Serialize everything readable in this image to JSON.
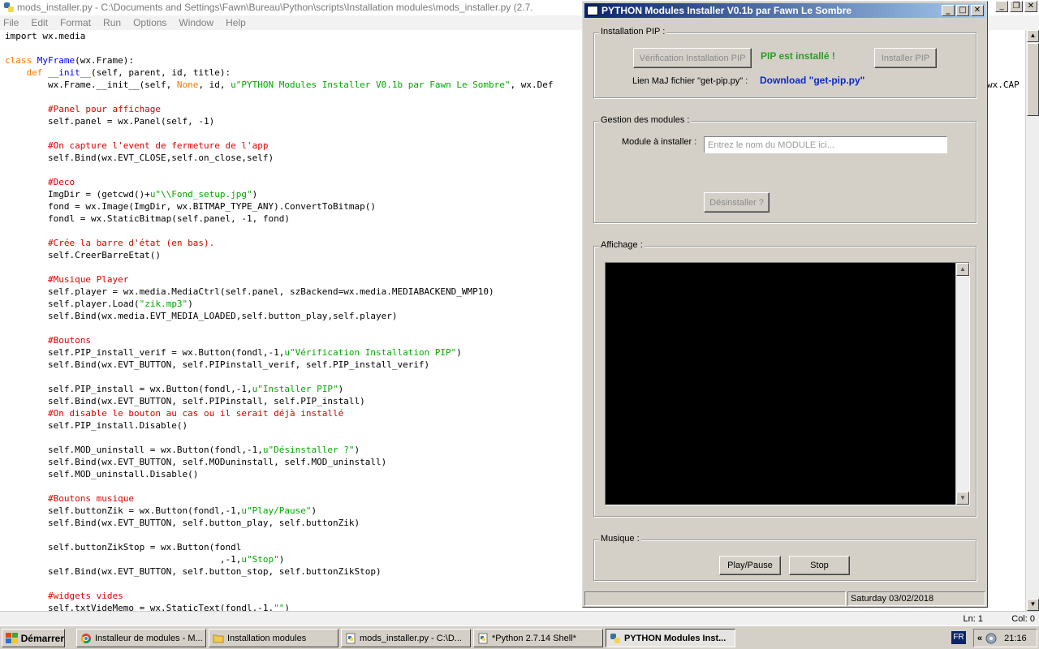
{
  "editor": {
    "title": "mods_installer.py - C:\\Documents and Settings\\Fawn\\Bureau\\Python\\scripts\\Installation modules\\mods_installer.py (2.7.",
    "menu": [
      "File",
      "Edit",
      "Format",
      "Run",
      "Options",
      "Window",
      "Help"
    ],
    "status_line": "Ln: 1",
    "status_col": "Col: 0",
    "code_lines": [
      [
        {
          "t": "import wx.media",
          "c": ""
        }
      ],
      [],
      [
        {
          "t": "class ",
          "c": "kw"
        },
        {
          "t": "MyFrame",
          "c": "cls"
        },
        {
          "t": "(wx.Frame):",
          "c": ""
        }
      ],
      [
        {
          "t": "    ",
          "c": ""
        },
        {
          "t": "def ",
          "c": "kw"
        },
        {
          "t": "__init__",
          "c": "cls"
        },
        {
          "t": "(self, parent, id, title):",
          "c": ""
        }
      ],
      [
        {
          "t": "        wx.Frame.__init__(self, ",
          "c": ""
        },
        {
          "t": "None",
          "c": "kw"
        },
        {
          "t": ", id, ",
          "c": ""
        },
        {
          "t": "u\"PYTHON Modules Installer V0.1b par Fawn Le Sombre\"",
          "c": "str"
        },
        {
          "t": ", wx.Def",
          "c": ""
        }
      ],
      [],
      [
        {
          "t": "        #Panel pour affichage",
          "c": "cmt"
        }
      ],
      [
        {
          "t": "        self.panel = wx.Panel(self, -1)",
          "c": ""
        }
      ],
      [],
      [
        {
          "t": "        #On capture l'event de fermeture de l'app",
          "c": "cmt"
        }
      ],
      [
        {
          "t": "        self.Bind(wx.EVT_CLOSE,self.on_close,self)",
          "c": ""
        }
      ],
      [],
      [
        {
          "t": "        #Deco",
          "c": "cmt"
        }
      ],
      [
        {
          "t": "        ImgDir = (getcwd()+",
          "c": ""
        },
        {
          "t": "u\"\\\\Fond_setup.jpg\"",
          "c": "str"
        },
        {
          "t": ")",
          "c": ""
        }
      ],
      [
        {
          "t": "        fond = wx.Image(ImgDir, wx.BITMAP_TYPE_ANY).ConvertToBitmap()",
          "c": ""
        }
      ],
      [
        {
          "t": "        fondl = wx.StaticBitmap(self.panel, -1, fond)",
          "c": ""
        }
      ],
      [],
      [
        {
          "t": "        #Crée la barre d'état (en bas).",
          "c": "cmt"
        }
      ],
      [
        {
          "t": "        self.CreerBarreEtat()",
          "c": ""
        }
      ],
      [],
      [
        {
          "t": "        #Musique Player",
          "c": "cmt"
        }
      ],
      [
        {
          "t": "        self.player = wx.media.MediaCtrl(self.panel, szBackend=wx.media.MEDIABACKEND_WMP10)",
          "c": ""
        }
      ],
      [
        {
          "t": "        self.player.Load(",
          "c": ""
        },
        {
          "t": "\"zik.mp3\"",
          "c": "str"
        },
        {
          "t": ")",
          "c": ""
        }
      ],
      [
        {
          "t": "        self.Bind(wx.media.EVT_MEDIA_LOADED,self.button_play,self.player)",
          "c": ""
        }
      ],
      [],
      [
        {
          "t": "        #Boutons",
          "c": "cmt"
        }
      ],
      [
        {
          "t": "        self.PIP_install_verif = wx.Button(fondl,-1,",
          "c": ""
        },
        {
          "t": "u\"Vérification Installation PIP\"",
          "c": "str"
        },
        {
          "t": ")",
          "c": ""
        }
      ],
      [
        {
          "t": "        self.Bind(wx.EVT_BUTTON, self.PIPinstall_verif, self.PIP_install_verif)",
          "c": ""
        }
      ],
      [],
      [
        {
          "t": "        self.PIP_install = wx.Button(fondl,-1,",
          "c": ""
        },
        {
          "t": "u\"Installer PIP\"",
          "c": "str"
        },
        {
          "t": ")",
          "c": ""
        }
      ],
      [
        {
          "t": "        self.Bind(wx.EVT_BUTTON, self.PIPinstall, self.PIP_install)",
          "c": ""
        }
      ],
      [
        {
          "t": "        #On disable le bouton au cas ou il serait déjà installé",
          "c": "cmt"
        }
      ],
      [
        {
          "t": "        self.PIP_install.Disable()",
          "c": ""
        }
      ],
      [],
      [
        {
          "t": "        self.MOD_uninstall = wx.Button(fondl,-1,",
          "c": ""
        },
        {
          "t": "u\"Désinstaller ?\"",
          "c": "str"
        },
        {
          "t": ")",
          "c": ""
        }
      ],
      [
        {
          "t": "        self.Bind(wx.EVT_BUTTON, self.MODuninstall, self.MOD_uninstall)",
          "c": ""
        }
      ],
      [
        {
          "t": "        self.MOD_uninstall.Disable()",
          "c": ""
        }
      ],
      [],
      [
        {
          "t": "        #Boutons musique",
          "c": "cmt"
        }
      ],
      [
        {
          "t": "        self.buttonZik = wx.Button(fondl,-1,",
          "c": ""
        },
        {
          "t": "u\"Play/Pause\"",
          "c": "str"
        },
        {
          "t": ")",
          "c": ""
        }
      ],
      [
        {
          "t": "        self.Bind(wx.EVT_BUTTON, self.button_play, self.buttonZik)",
          "c": ""
        }
      ],
      [],
      [
        {
          "t": "        self.buttonZikStop = wx.Button(fondl",
          "c": ""
        }
      ],
      [
        {
          "t": "                                        ,-1,",
          "c": ""
        },
        {
          "t": "u\"Stop\"",
          "c": "str"
        },
        {
          "t": ")",
          "c": ""
        }
      ],
      [
        {
          "t": "        self.Bind(wx.EVT_BUTTON, self.button_stop, self.buttonZikStop)",
          "c": ""
        }
      ],
      [],
      [
        {
          "t": "        #widgets vides",
          "c": "cmt"
        }
      ],
      [
        {
          "t": "        self.txtVideMemo = wx.StaticText(fondl,-1,",
          "c": ""
        },
        {
          "t": "\"\"",
          "c": "str"
        },
        {
          "t": ")",
          "c": ""
        }
      ]
    ],
    "right_overflow_text": "wx.CAP"
  },
  "app": {
    "title": "PYTHON Modules Installer V0.1b par Fawn Le Sombre",
    "pip_group": {
      "label": "Installation PIP :",
      "verify_button": "Vérification Installation PIP",
      "status_text": "PIP est installé !",
      "install_button": "Installer PIP",
      "link_label": "Lien MaJ fichier \"get-pip.py\" :",
      "link_text": "Download \"get-pip.py\""
    },
    "modules_group": {
      "label": "Gestion des modules :",
      "field_label": "Module à installer :",
      "field_placeholder": "Entrez le nom du MODULE ici...",
      "field_value": "",
      "uninstall_button": "Désinstaller ?"
    },
    "display_group": {
      "label": "Affichage :"
    },
    "music_group": {
      "label": "Musique :",
      "play_button": "Play/Pause",
      "stop_button": "Stop"
    },
    "statusbar": {
      "left": "",
      "right": "Saturday 03/02/2018"
    }
  },
  "taskbar": {
    "start": "Démarrer",
    "tasks": [
      {
        "label": "Installeur de modules - M...",
        "icon": "chrome-icon",
        "active": false
      },
      {
        "label": "Installation modules",
        "icon": "folder-icon",
        "active": false
      },
      {
        "label": "mods_installer.py - C:\\D...",
        "icon": "python-file-icon",
        "active": false
      },
      {
        "label": "*Python 2.7.14 Shell*",
        "icon": "python-shell-icon",
        "active": false
      },
      {
        "label": "PYTHON Modules Inst...",
        "icon": "window-icon",
        "active": true
      }
    ],
    "language": "FR",
    "clock": "21:16"
  }
}
